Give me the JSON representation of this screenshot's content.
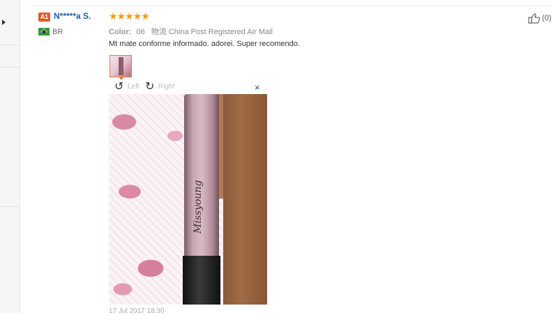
{
  "reviewer": {
    "level_badge": "A1",
    "name": "N*****a S.",
    "country": "BR"
  },
  "review": {
    "stars": "★★★★★",
    "color_label": "Color:",
    "color_value": "06",
    "shipping": "物流 China Post Registered Air Mail",
    "text": "Mt mate conforme informado. adorei. Super recomendo.",
    "date": "17 Jul 2017 18:30"
  },
  "viewer": {
    "rotate_left": "Left",
    "rotate_right": "Right",
    "close": "×",
    "brand_on_tube": "Missyoung"
  },
  "helpful": {
    "count": "(0)"
  },
  "colors": {
    "star": "#ff9a00",
    "name": "#1d5dac",
    "badge": "#e05a2b",
    "thumb_border": "#e57b2a"
  }
}
